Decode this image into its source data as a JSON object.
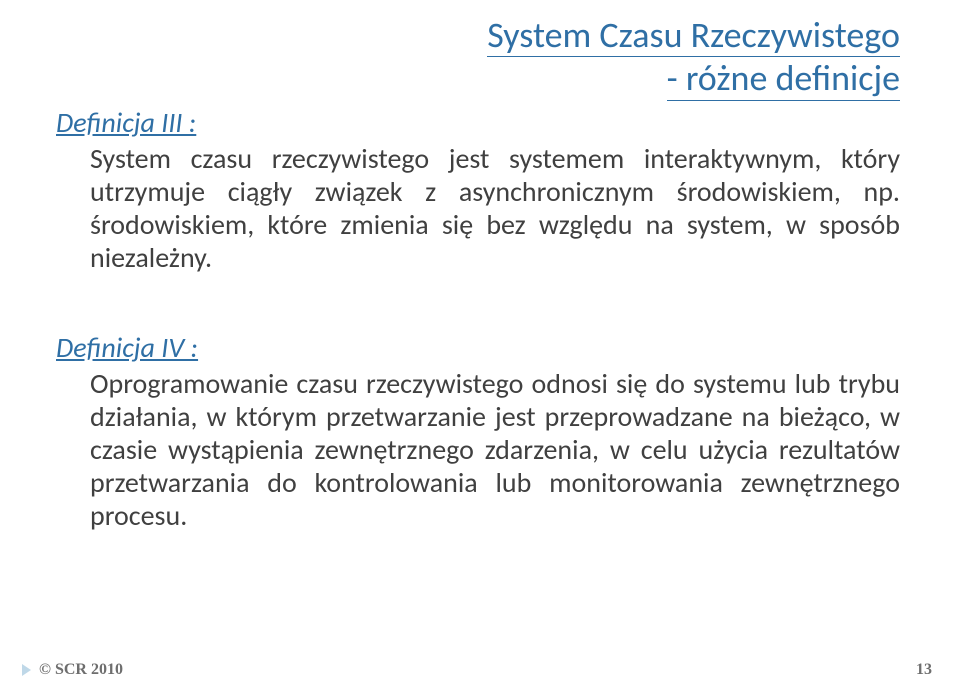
{
  "title_line1": "System Czasu Rzeczywistego",
  "title_line2": "- różne definicje",
  "def3": {
    "heading": "Definicja III :",
    "text": "System czasu rzeczywistego jest systemem interaktywnym, który utrzymuje ciągły związek z asynchronicznym środowiskiem, np. środowiskiem, które zmienia się bez względu na system, w sposób niezależny."
  },
  "def4": {
    "heading": "Definicja IV :",
    "text": "Oprogramowanie czasu rzeczywistego odnosi się do systemu lub trybu działania, w którym przetwarzanie jest przeprowadzane na bieżąco, w czasie wystąpienia zewnętrznego zdarzenia, w celu użycia rezultatów przetwarzania do kontrolowania lub monitorowania zewnętrznego procesu."
  },
  "footer": {
    "copyright": "© SCR 2010",
    "page": "13"
  }
}
